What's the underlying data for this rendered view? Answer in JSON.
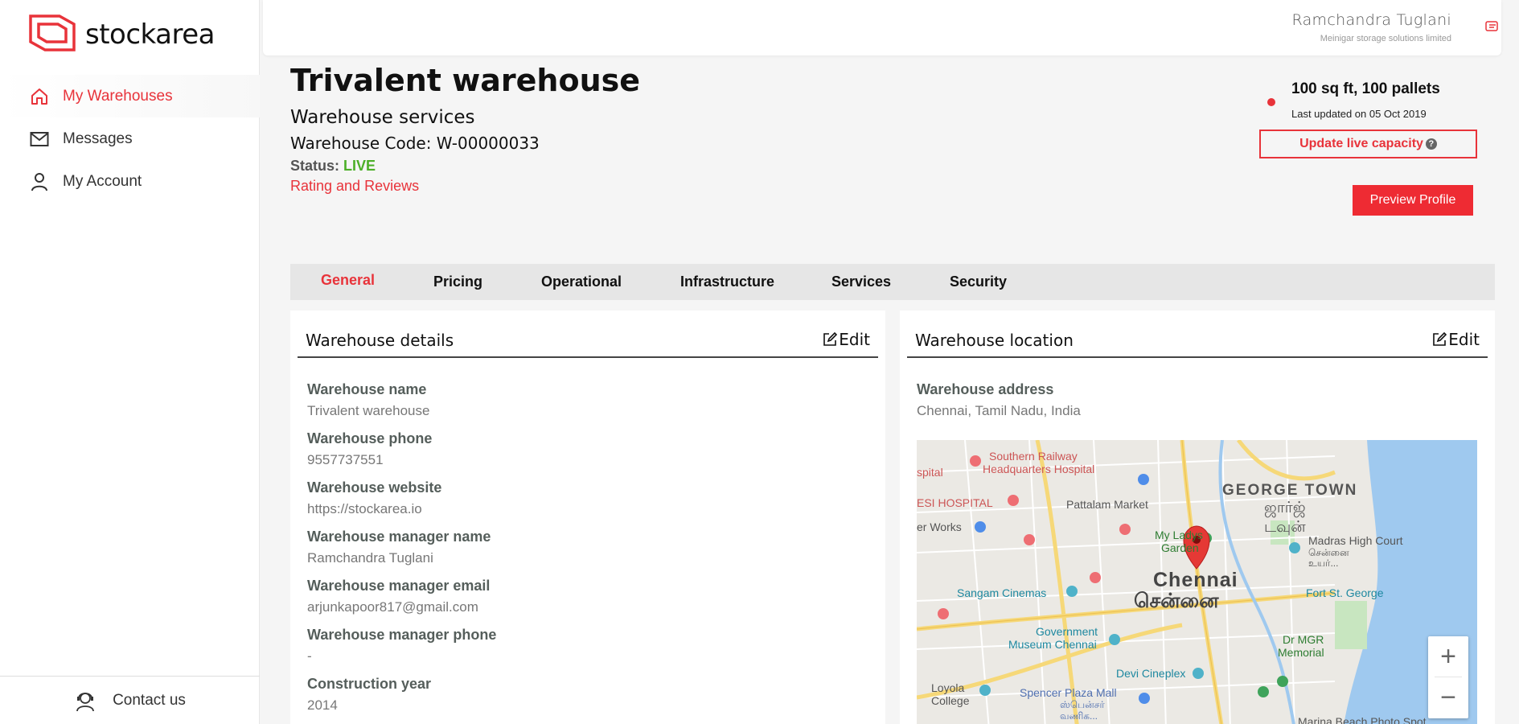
{
  "brand": {
    "name": "stockarea"
  },
  "sidebar": {
    "items": [
      {
        "label": "My Warehouses",
        "icon": "home-icon",
        "active": true
      },
      {
        "label": "Messages",
        "icon": "mail-icon",
        "active": false
      },
      {
        "label": "My Account",
        "icon": "user-icon",
        "active": false
      }
    ],
    "footer": {
      "label": "Contact us",
      "icon": "support-agent-icon"
    }
  },
  "user": {
    "name": "Ramchandra Tuglani",
    "company": "Meinigar storage solutions limited"
  },
  "warehouse": {
    "title": "Trivalent warehouse",
    "subtitle": "Warehouse services",
    "code": "Warehouse Code: W-00000033",
    "status_label": "Status:",
    "status_value": "LIVE",
    "rating_link": "Rating and Reviews"
  },
  "capacity": {
    "summary": "100 sq ft, 100 pallets",
    "updated": "Last updated on 05 Oct 2019",
    "update_button": "Update live capacity",
    "help": "?"
  },
  "preview_button": "Preview Profile",
  "tabs": [
    "General",
    "Pricing",
    "Operational",
    "Infrastructure",
    "Services",
    "Security"
  ],
  "active_tab": "General",
  "details_card": {
    "title": "Warehouse details",
    "edit_label": "Edit",
    "fields": [
      {
        "label": "Warehouse name",
        "value": "Trivalent warehouse"
      },
      {
        "label": "Warehouse phone",
        "value": "9557737551"
      },
      {
        "label": "Warehouse website",
        "value": "https://stockarea.io"
      },
      {
        "label": "Warehouse manager name",
        "value": "Ramchandra Tuglani"
      },
      {
        "label": "Warehouse manager email",
        "value": "arjunkapoor817@gmail.com"
      },
      {
        "label": "Warehouse manager phone",
        "value": "-"
      },
      {
        "label": "Construction year",
        "value": "2014"
      }
    ]
  },
  "location_card": {
    "title": "Warehouse location",
    "edit_label": "Edit",
    "address_label": "Warehouse address",
    "address_value": "Chennai, Tamil Nadu, India",
    "map": {
      "labels": {
        "hospital1": "Southern Railway",
        "hospital1b": "Headquarters Hospital",
        "spital": "spital",
        "esi": "ESI HOSPITAL",
        "pattalam": "Pattalam Market",
        "george": "GEORGE TOWN",
        "george_ta1": "ஜார்ஜ்",
        "george_ta2": "டவுன்",
        "works": "er Works",
        "ladys1": "My Ladys",
        "ladys2": "Garden",
        "court1": "Madras High Court",
        "court2": "சென்னை",
        "court3": "உயர்...",
        "chennai": "Chennai",
        "chennai_ta": "சென்னை",
        "sangam": "Sangam Cinemas",
        "fort": "Fort St. George",
        "gov1": "Government",
        "gov2": "Museum Chennai",
        "mgr1": "Dr MGR",
        "mgr2": "Memorial",
        "devi": "Devi Cineplex",
        "loyola1": "Loyola",
        "loyola2": "College",
        "spencer1": "Spencer Plaza Mall",
        "spencer2": "ஸ்பென்சர்",
        "spencer3": "வணிக...",
        "marina": "Marina Beach Photo Spot"
      },
      "zoom_in": "+",
      "zoom_out": "−"
    }
  },
  "colors": {
    "accent": "#e8333a",
    "live": "#4caf28"
  }
}
